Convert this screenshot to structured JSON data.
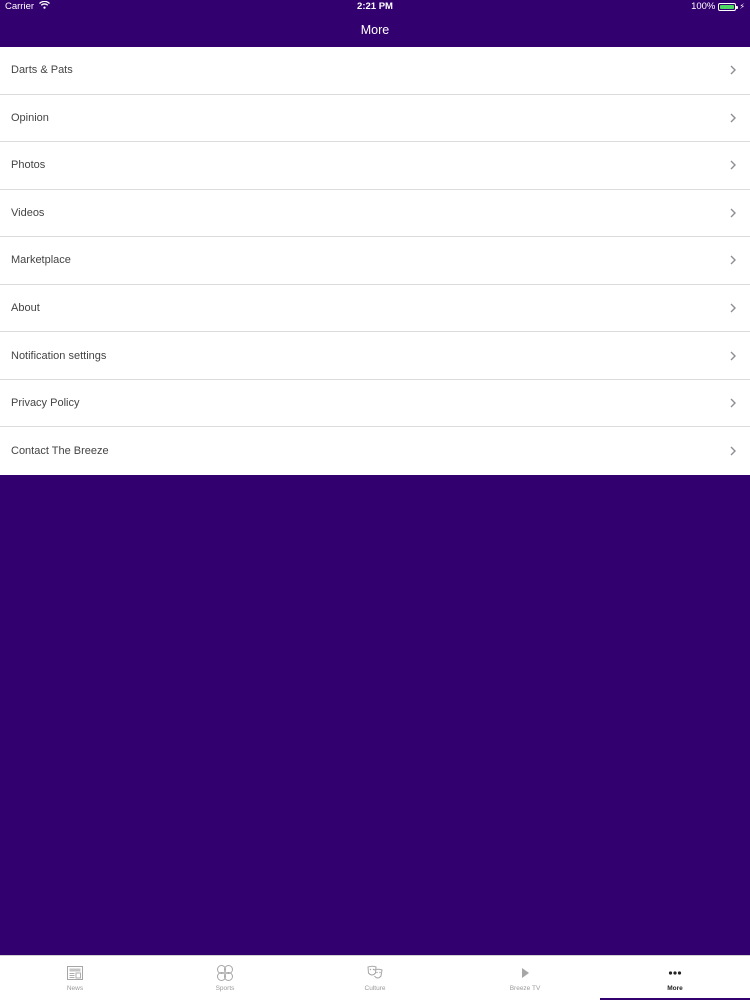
{
  "status_bar": {
    "carrier": "Carrier",
    "time": "2:21 PM",
    "battery": "100%",
    "battery_level": 1.0
  },
  "nav": {
    "title": "More"
  },
  "menu": {
    "items": [
      {
        "label": "Darts & Pats"
      },
      {
        "label": "Opinion"
      },
      {
        "label": "Photos"
      },
      {
        "label": "Videos"
      },
      {
        "label": "Marketplace"
      },
      {
        "label": "About"
      },
      {
        "label": "Notification settings"
      },
      {
        "label": "Privacy Policy"
      },
      {
        "label": "Contact The Breeze"
      }
    ],
    "chevron_icon": "chevron-right-icon"
  },
  "tabs": [
    {
      "label": "News",
      "icon": "newspaper-icon",
      "active": false
    },
    {
      "label": "Sports",
      "icon": "sports-icon",
      "active": false
    },
    {
      "label": "Culture",
      "icon": "theater-masks-icon",
      "active": false
    },
    {
      "label": "Breeze TV",
      "icon": "play-icon",
      "active": false
    },
    {
      "label": "More",
      "icon": "more-dots-icon",
      "active": true
    }
  ],
  "colors": {
    "brand_purple": "#33006f",
    "battery_green": "#4cd964",
    "active_tab": "#222222",
    "inactive_tab": "#9a9a9a"
  }
}
